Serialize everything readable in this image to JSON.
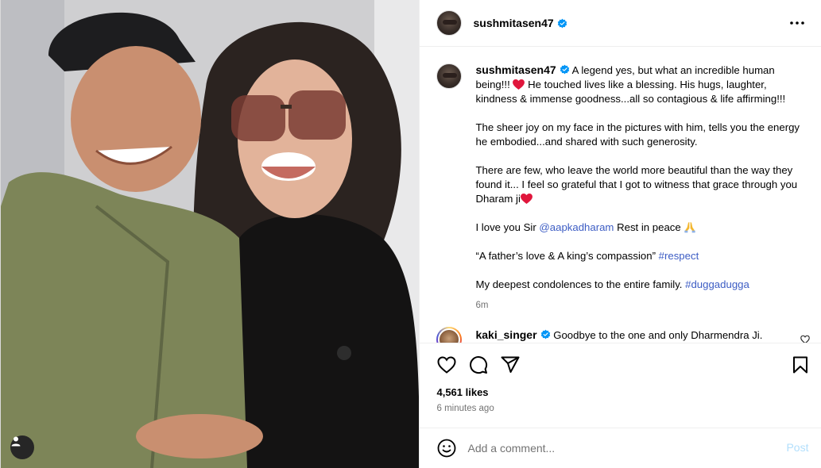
{
  "post": {
    "author": "sushmitasen47",
    "caption": {
      "p1_text": "A legend yes, but what an incredible human being!!! ",
      "p1_text_b": " He touched lives like a blessing. His hugs, laughter, kindness & immense goodness...all so contagious & life affirming!!!",
      "p2": "The sheer joy on my face in the pictures with him, tells you the energy he embodied...and shared with such generosity.",
      "p3": "There are few, who leave the world more beautiful than the way they found it... I feel so grateful that I got to witness that grace through you Dharam ji",
      "p4_a": "I love you Sir ",
      "p4_mention": "@aapkadharam",
      "p4_b": " Rest in peace ",
      "p5_a": "“A father’s love & A king’s compassion” ",
      "p5_tag": "#respect",
      "p6_a": "My deepest condolences to the entire family. ",
      "p6_tag": "#duggadugga",
      "time": "6m"
    },
    "top_comment": {
      "user": "kaki_singer",
      "text": "Goodbye to the one and only Dharmendra Ji."
    },
    "likes": "4,561 likes",
    "posted_ago": "6 minutes ago",
    "comment_input": {
      "placeholder": "Add a comment...",
      "value": ""
    },
    "post_label": "Post"
  },
  "icons": {
    "verified": "verified-badge-icon",
    "more": "more-options-icon",
    "like": "heart-icon",
    "comment": "comment-icon",
    "share": "share-icon",
    "save": "bookmark-icon",
    "emoji": "emoji-icon",
    "tagged": "user-tag-icon"
  },
  "colors": {
    "verified": "#0095f6",
    "link": "#3d5dc4",
    "heart_emoji": "#e0163c",
    "post_button_disabled": "#b2dffc",
    "secondary_text": "#737373"
  }
}
